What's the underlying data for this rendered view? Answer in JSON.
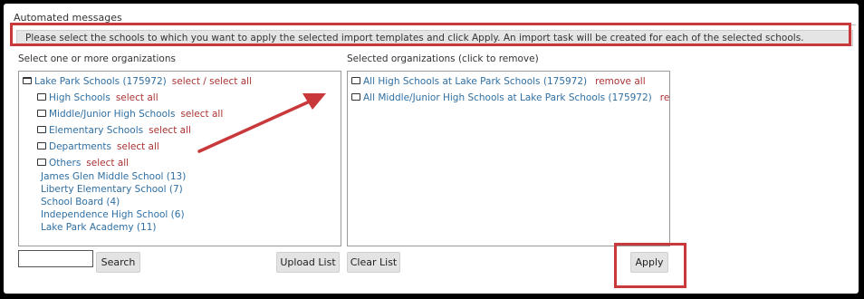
{
  "section_title": "Automated messages",
  "message": "Please select the schools to which you want to apply the selected import templates and click Apply. An import task will be created for each of the selected schools.",
  "left_panel": {
    "label": "Select one or more organizations",
    "root": {
      "name": "Lake Park Schools (175972)",
      "action": "select / select all"
    },
    "folders": [
      {
        "name": "High Schools",
        "action": "select all"
      },
      {
        "name": "Middle/Junior High Schools",
        "action": "select all"
      },
      {
        "name": "Elementary Schools",
        "action": "select all"
      },
      {
        "name": "Departments",
        "action": "select all"
      },
      {
        "name": "Others",
        "action": "select all"
      }
    ],
    "schools": [
      "James Glen Middle School (13)",
      "Liberty Elementary School (7)",
      "School Board (4)",
      "Independence High School (6)",
      "Lake Park Academy (11)"
    ]
  },
  "right_panel": {
    "label": "Selected organizations (click to remove)",
    "items": [
      {
        "name": "All High Schools at Lake Park Schools (175972)",
        "action": "remove all"
      },
      {
        "name": "All Middle/Junior High Schools at Lake Park Schools (175972)",
        "action": "remove all"
      }
    ]
  },
  "buttons": {
    "search": "Search",
    "upload_list": "Upload List",
    "clear_list": "Clear List",
    "apply": "Apply"
  },
  "search": {
    "value": "",
    "placeholder": ""
  },
  "colors": {
    "highlight": "#c9383a",
    "link": "#2f6fa3",
    "action": "#aa3333"
  }
}
